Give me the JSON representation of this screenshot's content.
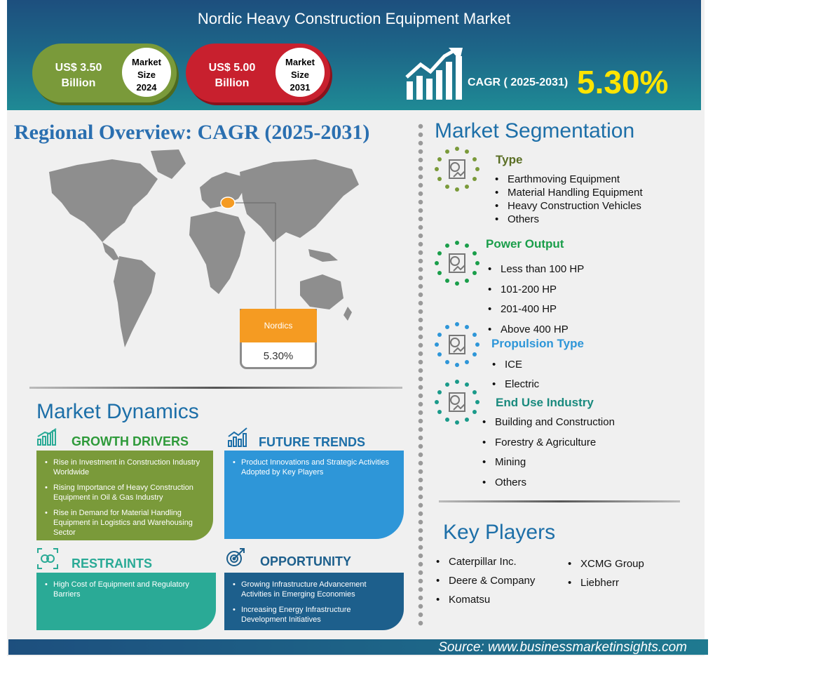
{
  "header": {
    "title": "Nordic Heavy Construction  Equipment Market",
    "size_2024": {
      "value_line1": "US$ 3.50",
      "value_line2": "Billion",
      "label_line1": "Market",
      "label_line2": "Size",
      "label_line3": "2024"
    },
    "size_2031": {
      "value_line1": "US$ 5.00",
      "value_line2": "Billion",
      "label_line1": "Market",
      "label_line2": "Size",
      "label_line3": "2031"
    },
    "cagr_label": "CAGR ( 2025-2031)",
    "cagr_value": "5.30%"
  },
  "regional": {
    "title": "Regional Overview: CAGR (2025-2031)",
    "callout_label": "Nordics",
    "callout_value": "5.30%"
  },
  "dynamics": {
    "title": "Market Dynamics",
    "drivers": {
      "heading": "GROWTH DRIVERS",
      "items": [
        "Rise in Investment in Construction Industry Worldwide",
        "Rising Importance of Heavy Construction Equipment in Oil & Gas Industry",
        "Rise in Demand for Material Handling Equipment in Logistics and Warehousing Sector"
      ]
    },
    "trends": {
      "heading": "FUTURE TRENDS",
      "items": [
        "Product Innovations and Strategic Activities Adopted by Key Players"
      ]
    },
    "restraints": {
      "heading": "RESTRAINTS",
      "items": [
        "High Cost of Equipment and Regulatory Barriers"
      ]
    },
    "opportunity": {
      "heading": "OPPORTUNITY",
      "items": [
        "Growing Infrastructure Advancement Activities in Emerging Economies",
        "Increasing Energy Infrastructure Development Initiatives"
      ]
    }
  },
  "segmentation": {
    "title": "Market Segmentation",
    "type": {
      "heading": "Type",
      "items": [
        "Earthmoving Equipment",
        "Material Handling Equipment",
        "Heavy Construction Vehicles",
        "Others"
      ]
    },
    "power": {
      "heading": "Power Output",
      "items": [
        "Less than 100 HP",
        "101-200  HP",
        "201-400  HP",
        "Above 400 HP"
      ]
    },
    "propulsion": {
      "heading": "Propulsion Type",
      "items": [
        "ICE",
        "Electric"
      ]
    },
    "end_use": {
      "heading": "End Use Industry",
      "items": [
        "Building and Construction",
        "Forestry  & Agriculture",
        "Mining",
        "Others"
      ]
    }
  },
  "key_players": {
    "title": "Key Players",
    "col1": [
      "Caterpillar Inc.",
      "Deere  & Company",
      "Komatsu"
    ],
    "col2": [
      "XCMG Group",
      "Liebherr"
    ]
  },
  "footer": {
    "source": "Source:  www.businessmarketinsights.com"
  },
  "colors": {
    "driver_green": "#7a9a3a",
    "trend_blue": "#2e96d8",
    "restraint_teal": "#2aaa96",
    "opportunity_navy": "#1d5f8c",
    "market_2031_red": "#c8202e",
    "cagr_yellow": "#ffe400",
    "nordics_orange": "#f59b22"
  }
}
